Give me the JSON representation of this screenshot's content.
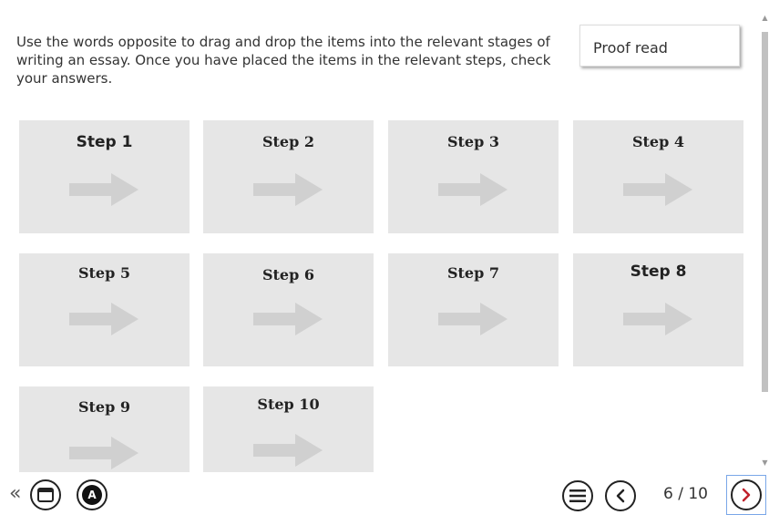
{
  "instructions": "Use the words opposite to drag and drop the items into the relevant stages of writing an essay. Once you have placed the items in the relevant steps, check your answers.",
  "drag_item": "Proof read",
  "steps": [
    "Step 1",
    "Step 2",
    "Step 3",
    "Step 4",
    "Step 5",
    "Step 6",
    "Step 7",
    "Step 8",
    "Step 9",
    "Step 10"
  ],
  "footer": {
    "back_glyph": "«",
    "accessibility_label": "A",
    "page_indicator": "6 / 10"
  },
  "colors": {
    "tile_bg": "#e6e6e6",
    "arrow": "#d0d0d0",
    "next_arrow": "#c0202a",
    "focus_outline": "#7aa7e8"
  },
  "icons": [
    "back-double-chevron-icon",
    "window-icon",
    "accessibility-icon",
    "menu-icon",
    "previous-icon",
    "next-icon"
  ]
}
